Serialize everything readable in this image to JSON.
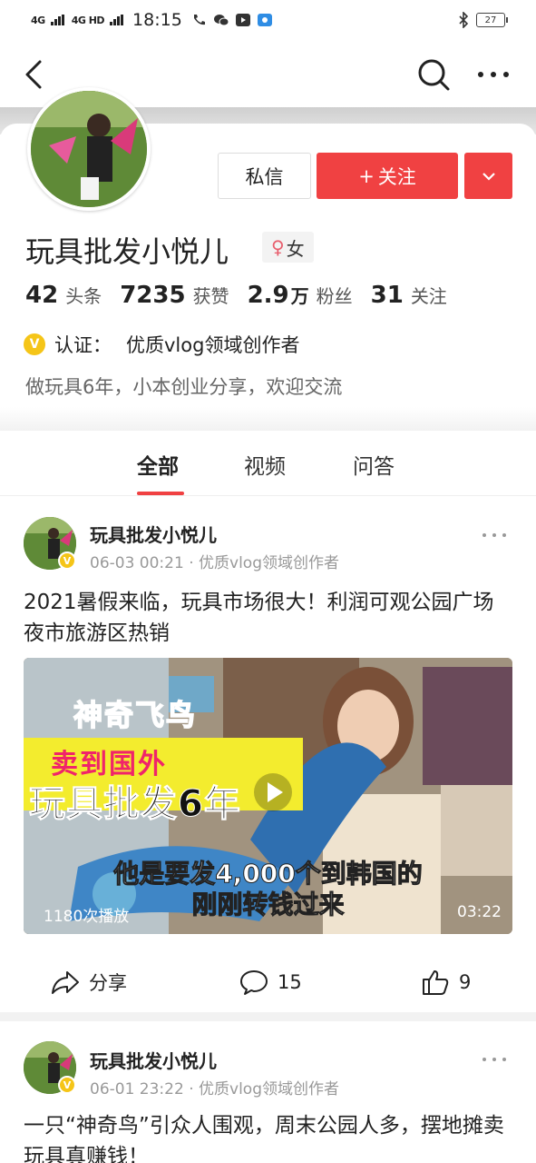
{
  "status_bar": {
    "network1": "4G",
    "network2": "4G HD",
    "time": "18:15",
    "battery": "27"
  },
  "nav": {
    "back_icon": "chevron-left-icon",
    "search_icon": "search-icon",
    "more_icon": "more-horizontal-icon"
  },
  "profile": {
    "message_label": "私信",
    "follow_label": "关注",
    "follow_prefix": "+",
    "name": "玩具批发小悦儿",
    "gender_symbol": "♀",
    "gender_label": "女",
    "stats": [
      {
        "num": "42",
        "unit": "",
        "label": "头条"
      },
      {
        "num": "7235",
        "unit": "",
        "label": "获赞"
      },
      {
        "num": "2.9",
        "unit": "万",
        "label": "粉丝"
      },
      {
        "num": "31",
        "unit": "",
        "label": "关注"
      }
    ],
    "verify_badge": "V",
    "verify_label": "认证：",
    "verify_text": "优质vlog领域创作者",
    "bio": "做玩具6年，小本创业分享，欢迎交流"
  },
  "tabs": [
    {
      "label": "全部",
      "active": true
    },
    {
      "label": "视频",
      "active": false
    },
    {
      "label": "问答",
      "active": false
    }
  ],
  "posts": [
    {
      "author": "玩具批发小悦儿",
      "meta": "06-03 00:21 · 优质vlog领域创作者",
      "text": "2021暑假来临，玩具市场很大！利润可观公园广场夜市旅游区热销",
      "video": {
        "pink_title": "神奇飞鸟",
        "red_title": "卖到国外",
        "big_title": "玩具批发6年",
        "subtitle_line1": "他是要发4,000个到韩国的",
        "subtitle_line2": "刚刚转钱过来",
        "plays": "1180次播放",
        "duration": "03:22"
      },
      "share_label": "分享",
      "comments": "15",
      "likes": "9"
    },
    {
      "author": "玩具批发小悦儿",
      "meta": "06-01 23:22 · 优质vlog领域创作者",
      "text": "一只“神奇鸟”引众人围观，周末公园人多，摆地摊卖玩具真赚钱！"
    }
  ],
  "colors": {
    "accent": "#f04142",
    "badge": "#f5c518",
    "muted": "#999999"
  }
}
